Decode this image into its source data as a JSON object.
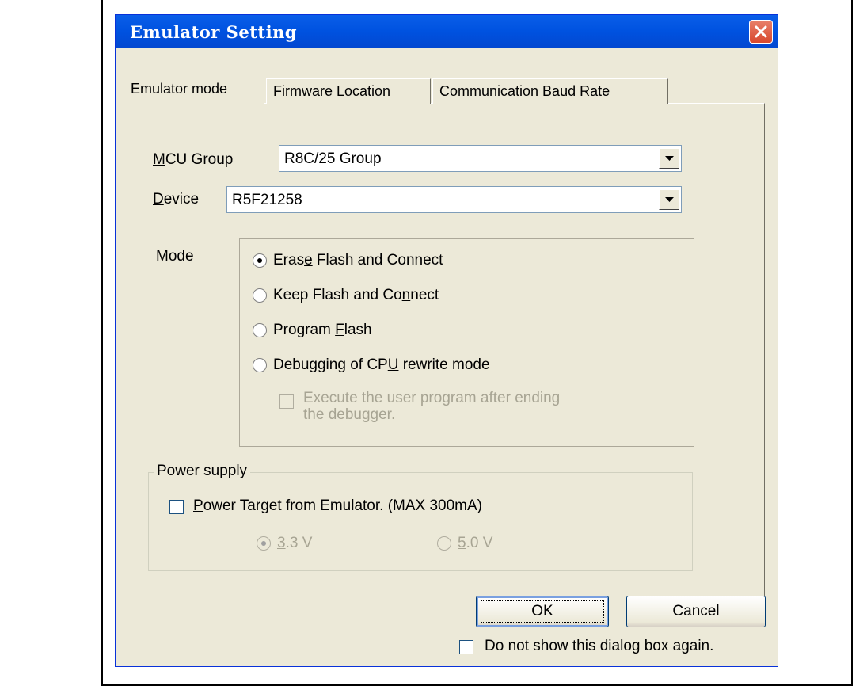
{
  "dialog": {
    "title": "Emulator Setting",
    "close_icon": "close-icon"
  },
  "tabs": [
    {
      "label": "Emulator mode",
      "active": true
    },
    {
      "label": "Firmware Location",
      "active": false
    },
    {
      "label": "Communication Baud Rate",
      "active": false
    }
  ],
  "mcu_group": {
    "label_underline": "M",
    "label_rest": "CU Group",
    "value": "R8C/25 Group"
  },
  "device": {
    "label_underline": "D",
    "label_rest": "evice",
    "value": "R5F21258"
  },
  "mode": {
    "label": "Mode",
    "options": [
      {
        "pre": "Eras",
        "ul": "e",
        "post": " Flash and Connect",
        "selected": true
      },
      {
        "pre": "Keep Flash and Co",
        "ul": "n",
        "post": "nect",
        "selected": false
      },
      {
        "pre": "Program ",
        "ul": "F",
        "post": "lash",
        "selected": false
      },
      {
        "pre": "Debugging of CP",
        "ul": "U",
        "post": " rewrite mode",
        "selected": false
      }
    ],
    "execute_after_debug": {
      "line1": "Execute the user program after ending",
      "line2": "the debugger.",
      "checked": false,
      "enabled": false
    }
  },
  "power_supply": {
    "legend": "Power supply",
    "power_target": {
      "ul": "P",
      "rest": "ower Target from Emulator. (MAX 300mA)",
      "checked": false
    },
    "voltages": [
      {
        "ul": "3",
        "rest": ".3 V",
        "selected": true,
        "enabled": false
      },
      {
        "ul": "5",
        "rest": ".0 V",
        "selected": false,
        "enabled": false
      }
    ]
  },
  "buttons": {
    "ok": "OK",
    "cancel": "Cancel"
  },
  "dont_show_again": {
    "label": "Do not show this dialog box again.",
    "checked": false
  },
  "colors": {
    "titlebar": "#0053e1",
    "dialog_bg": "#ece9d8",
    "close_button": "#d8482e"
  }
}
